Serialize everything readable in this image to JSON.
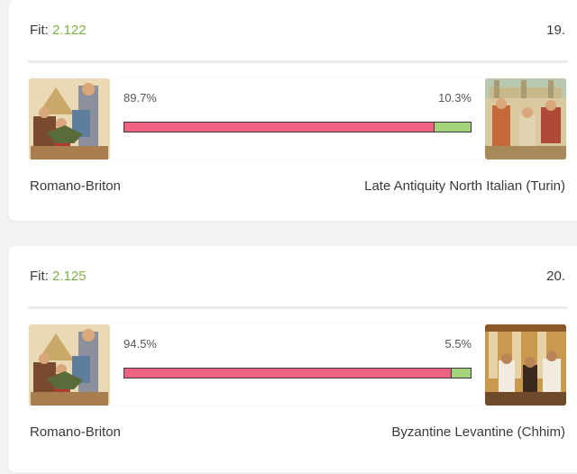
{
  "results": [
    {
      "fit_label": "Fit: ",
      "fit_value": "2.122",
      "rank": "19.",
      "left_pct": "89.7%",
      "right_pct": "10.3%",
      "left_share": 0.897,
      "left_name": "Romano-Briton",
      "right_name": "Late Antiquity North Italian (Turin)"
    },
    {
      "fit_label": "Fit: ",
      "fit_value": "2.125",
      "rank": "20.",
      "left_pct": "94.5%",
      "right_pct": "5.5%",
      "left_share": 0.945,
      "left_name": "Romano-Briton",
      "right_name": "Byzantine Levantine (Chhim)"
    }
  ],
  "colors": {
    "fit_value": "#7cb342",
    "left_bar": "#f06282",
    "right_bar": "#a3d47c"
  }
}
